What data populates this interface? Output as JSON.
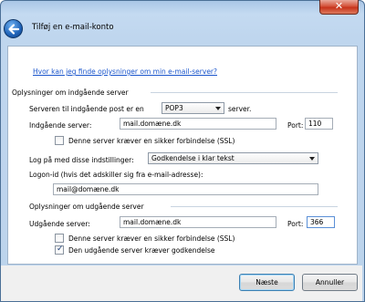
{
  "window": {
    "title": "Tilføj en e-mail-konto",
    "close_glyph": "✕",
    "back_icon": "back-arrow-icon"
  },
  "help_link": "Hvor kan jeg finde oplysninger om min e-mail-server?",
  "incoming": {
    "section_title": "Oplysninger om indgående server",
    "server_type_prefix": "Serveren til indgående post er en",
    "server_type_value": "POP3",
    "server_type_suffix": "server.",
    "server_label": "Indgående server:",
    "server_value": "mail.domæne.dk",
    "port_label": "Port:",
    "port_value": "110",
    "ssl_label": "Denne server kræver en sikker forbindelse (SSL)",
    "ssl_checked": false,
    "logon_label": "Log på med disse indstillinger:",
    "logon_value": "Godkendelse i klar tekst",
    "logonid_label": "Logon-id (hvis det adskiller sig fra e-mail-adresse):",
    "logonid_value": "mail@domæne.dk"
  },
  "outgoing": {
    "section_title": "Oplysninger om udgående server",
    "server_label": "Udgående server:",
    "server_value": "mail.domæne.dk",
    "port_label": "Port:",
    "port_value": "366",
    "ssl_label": "Denne server kræver en sikker forbindelse (SSL)",
    "ssl_checked": false,
    "auth_label": "Den udgående server kræver godkendelse",
    "auth_checked": true,
    "check_glyph": "✓"
  },
  "buttons": {
    "next": "Næste",
    "cancel": "Annuller"
  }
}
